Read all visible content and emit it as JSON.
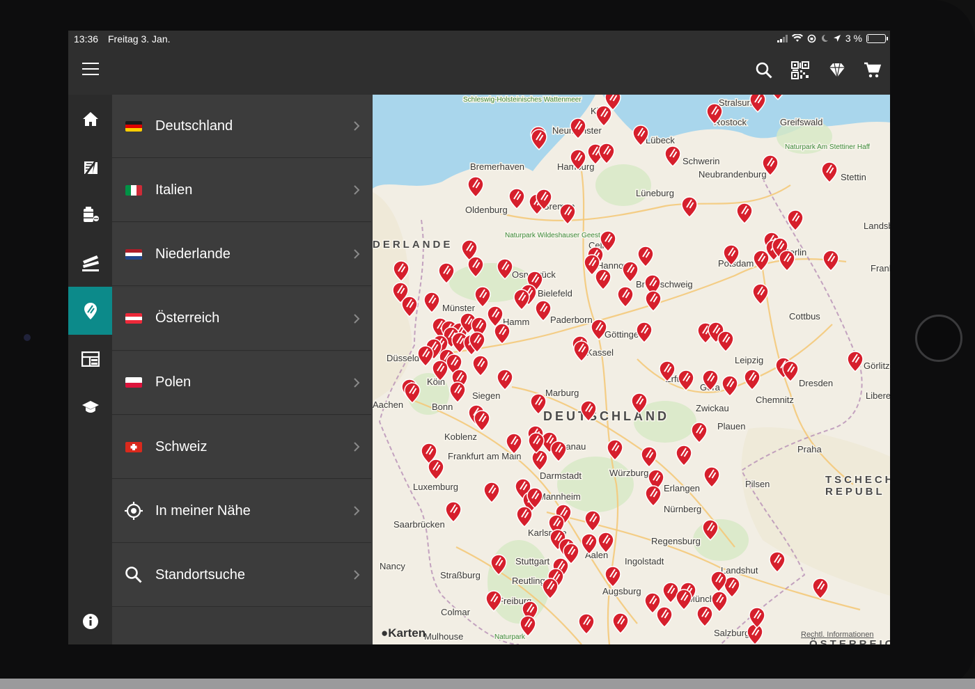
{
  "status_bar": {
    "time": "13:36",
    "date": "Freitag 3. Jan.",
    "battery": "3 %",
    "battery_level": 0.03
  },
  "toolbar": {
    "icons": [
      "menu-icon",
      "search-icon",
      "qr-code-icon",
      "diamond-icon",
      "cart-icon"
    ]
  },
  "rail": {
    "items": [
      {
        "icon": "home-icon"
      },
      {
        "icon": "tire-icon"
      },
      {
        "icon": "oil-icon"
      },
      {
        "icon": "car-wash-icon"
      },
      {
        "icon": "location-pin-icon",
        "active": true
      },
      {
        "icon": "layout-icon"
      },
      {
        "icon": "graduation-cap-icon"
      },
      {
        "icon": "info-icon"
      }
    ]
  },
  "list": {
    "items": [
      {
        "label": "Deutschland",
        "flag": [
          "#1a1a1a",
          "#dd0000",
          "#ffce00"
        ],
        "dir": "v"
      },
      {
        "label": "Italien",
        "flag": [
          "#009246",
          "#ffffff",
          "#ce2b37"
        ],
        "dir": "h"
      },
      {
        "label": "Niederlande",
        "flag": [
          "#ae1c28",
          "#ffffff",
          "#21468b"
        ],
        "dir": "v"
      },
      {
        "label": "Österreich",
        "flag": [
          "#ed2939",
          "#ffffff",
          "#ed2939"
        ],
        "dir": "v"
      },
      {
        "label": "Polen",
        "flag": [
          "#ffffff",
          "#dc143c"
        ],
        "dir": "v"
      },
      {
        "label": "Schweiz",
        "flag": [
          "#da291c"
        ],
        "dir": "v",
        "cross": true
      },
      {
        "label": "In meiner Nähe",
        "icon": "crosshair-icon"
      },
      {
        "label": "Standortsuche",
        "icon": "search-icon"
      }
    ]
  },
  "map": {
    "credit": "Karten",
    "legal": "Rechtl. Informationen",
    "country_labels": [
      "DEUTSCHLAND",
      "TSCHECHI",
      "REPUBL",
      "DERLANDE",
      "ÖSTERREICH"
    ],
    "city_labels": [
      "Schleswig-Holsteinisches Wattenmeer",
      "Kiel",
      "Neumünster",
      "Stralsund",
      "Rostock",
      "Greifswald",
      "Lübeck",
      "Schwerin",
      "Neubrandenburg",
      "Naturpark Am Stettiner Haff",
      "Stettin",
      "Bremerhaven",
      "Hamburg",
      "Lüneburg",
      "Oldenburg",
      "Bremen",
      "Naturpark Wildeshauser Geest",
      "Celle",
      "Berlin",
      "Landsberg",
      "Frankfurt (Oder)",
      "Osnabrück",
      "Hannover",
      "Potsdam",
      "Braunschweig",
      "Bielefeld",
      "Münster",
      "Hamm",
      "Paderborn",
      "Cottbus",
      "Göttingen",
      "Kassel",
      "Leipzig",
      "Düsseldorf",
      "Görlitz",
      "Köln",
      "Siegen",
      "Erfurt",
      "Gera",
      "Dresden",
      "Aachen",
      "Bonn",
      "Marburg",
      "Chemnitz",
      "Zwickau",
      "Liberec",
      "Plauen",
      "Koblenz",
      "Hanau",
      "Praha",
      "Frankfurt am Main",
      "Darmstadt",
      "Würzburg",
      "Luxemburg",
      "Erlangen",
      "Pilsen",
      "Mannheim",
      "Nürnberg",
      "Saarbrücken",
      "Karlsruhe",
      "Regensburg",
      "Aalen",
      "Ingolstadt",
      "Stuttgart",
      "Nancy",
      "Straßburg",
      "Reutlingen",
      "Landshut",
      "Augsburg",
      "München",
      "Freiburg",
      "Colmar",
      "Naturpark",
      "Mulhouse",
      "Salzburg"
    ]
  }
}
